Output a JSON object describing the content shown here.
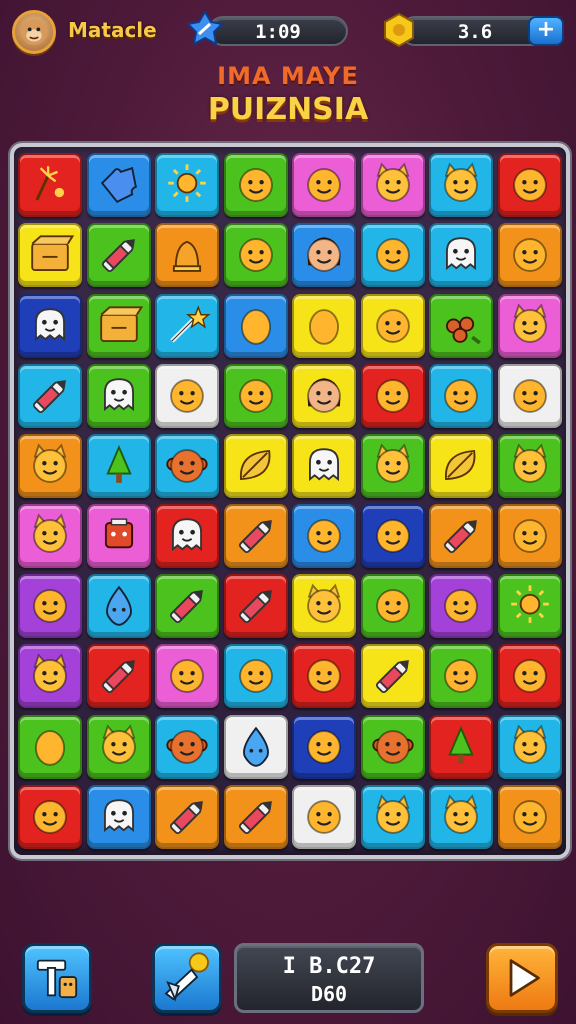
{
  "hud": {
    "player_name": "Matacle",
    "timer": "1:09",
    "coins": "3.6",
    "plus_label": "+"
  },
  "title": {
    "line1": "IMA MAYE",
    "line2": "PUIZNSIA"
  },
  "colors": {
    "red": "#e2231f",
    "blue": "#2a8ee8",
    "cyan": "#22b6e8",
    "green": "#4cc21f",
    "pink": "#ec5ed6",
    "purple": "#a441d8",
    "yellow": "#f6e318",
    "orange": "#f2921a",
    "white": "#f0f0f0",
    "navy": "#1f3fb8"
  },
  "board": {
    "rows": [
      [
        {
          "c": "red",
          "i": "sparkler"
        },
        {
          "c": "blue",
          "i": "puzzle"
        },
        {
          "c": "cyan",
          "i": "sun"
        },
        {
          "c": "green",
          "i": "smile"
        },
        {
          "c": "pink",
          "i": "smile"
        },
        {
          "c": "pink",
          "i": "cat"
        },
        {
          "c": "cyan",
          "i": "cat"
        },
        {
          "c": "red",
          "i": "smile"
        }
      ],
      [
        {
          "c": "yellow",
          "i": "box"
        },
        {
          "c": "green",
          "i": "crayon"
        },
        {
          "c": "orange",
          "i": "bell"
        },
        {
          "c": "green",
          "i": "smile"
        },
        {
          "c": "blue",
          "i": "girl"
        },
        {
          "c": "cyan",
          "i": "smile"
        },
        {
          "c": "cyan",
          "i": "ghost"
        },
        {
          "c": "orange",
          "i": "smile"
        }
      ],
      [
        {
          "c": "navy",
          "i": "ghost"
        },
        {
          "c": "green",
          "i": "box"
        },
        {
          "c": "cyan",
          "i": "wand"
        },
        {
          "c": "blue",
          "i": "egg"
        },
        {
          "c": "yellow",
          "i": "egg"
        },
        {
          "c": "yellow",
          "i": "smile"
        },
        {
          "c": "green",
          "i": "berries"
        },
        {
          "c": "pink",
          "i": "cat"
        }
      ],
      [
        {
          "c": "cyan",
          "i": "crayon"
        },
        {
          "c": "green",
          "i": "ghost"
        },
        {
          "c": "white",
          "i": "smile"
        },
        {
          "c": "green",
          "i": "smile"
        },
        {
          "c": "yellow",
          "i": "girl"
        },
        {
          "c": "red",
          "i": "smile"
        },
        {
          "c": "cyan",
          "i": "smile"
        },
        {
          "c": "white",
          "i": "smile"
        }
      ],
      [
        {
          "c": "orange",
          "i": "cat"
        },
        {
          "c": "cyan",
          "i": "tree"
        },
        {
          "c": "cyan",
          "i": "monkey"
        },
        {
          "c": "yellow",
          "i": "leaf"
        },
        {
          "c": "yellow",
          "i": "ghost"
        },
        {
          "c": "green",
          "i": "cat"
        },
        {
          "c": "yellow",
          "i": "leaf"
        },
        {
          "c": "green",
          "i": "cat"
        }
      ],
      [
        {
          "c": "pink",
          "i": "cat"
        },
        {
          "c": "pink",
          "i": "robot"
        },
        {
          "c": "red",
          "i": "ghost"
        },
        {
          "c": "orange",
          "i": "crayon"
        },
        {
          "c": "blue",
          "i": "smile"
        },
        {
          "c": "navy",
          "i": "smile"
        },
        {
          "c": "orange",
          "i": "crayon"
        },
        {
          "c": "orange",
          "i": "smile"
        }
      ],
      [
        {
          "c": "purple",
          "i": "smile"
        },
        {
          "c": "cyan",
          "i": "drop"
        },
        {
          "c": "green",
          "i": "crayon"
        },
        {
          "c": "red",
          "i": "crayon"
        },
        {
          "c": "yellow",
          "i": "cat"
        },
        {
          "c": "green",
          "i": "smile"
        },
        {
          "c": "purple",
          "i": "smile"
        },
        {
          "c": "green",
          "i": "sun"
        }
      ],
      [
        {
          "c": "purple",
          "i": "cat"
        },
        {
          "c": "red",
          "i": "crayon"
        },
        {
          "c": "pink",
          "i": "smile"
        },
        {
          "c": "cyan",
          "i": "smile"
        },
        {
          "c": "red",
          "i": "smile"
        },
        {
          "c": "yellow",
          "i": "crayon"
        },
        {
          "c": "green",
          "i": "smile"
        },
        {
          "c": "red",
          "i": "smile"
        }
      ],
      [
        {
          "c": "green",
          "i": "egg"
        },
        {
          "c": "green",
          "i": "cat"
        },
        {
          "c": "cyan",
          "i": "monkey"
        },
        {
          "c": "white",
          "i": "drop"
        },
        {
          "c": "navy",
          "i": "smile"
        },
        {
          "c": "green",
          "i": "monkey"
        },
        {
          "c": "red",
          "i": "tree"
        },
        {
          "c": "cyan",
          "i": "cat"
        }
      ],
      [
        {
          "c": "red",
          "i": "smile"
        },
        {
          "c": "blue",
          "i": "ghost"
        },
        {
          "c": "orange",
          "i": "crayon"
        },
        {
          "c": "orange",
          "i": "crayon"
        },
        {
          "c": "white",
          "i": "smile"
        },
        {
          "c": "cyan",
          "i": "cat"
        },
        {
          "c": "cyan",
          "i": "cat"
        },
        {
          "c": "orange",
          "i": "smile"
        }
      ]
    ]
  },
  "bottom": {
    "left_button_icon": "hammer-icon",
    "mid_button_icon": "rocket-icon",
    "score_line1": "I B.C27",
    "score_line2": "D60",
    "play_button_icon": "play-icon"
  }
}
